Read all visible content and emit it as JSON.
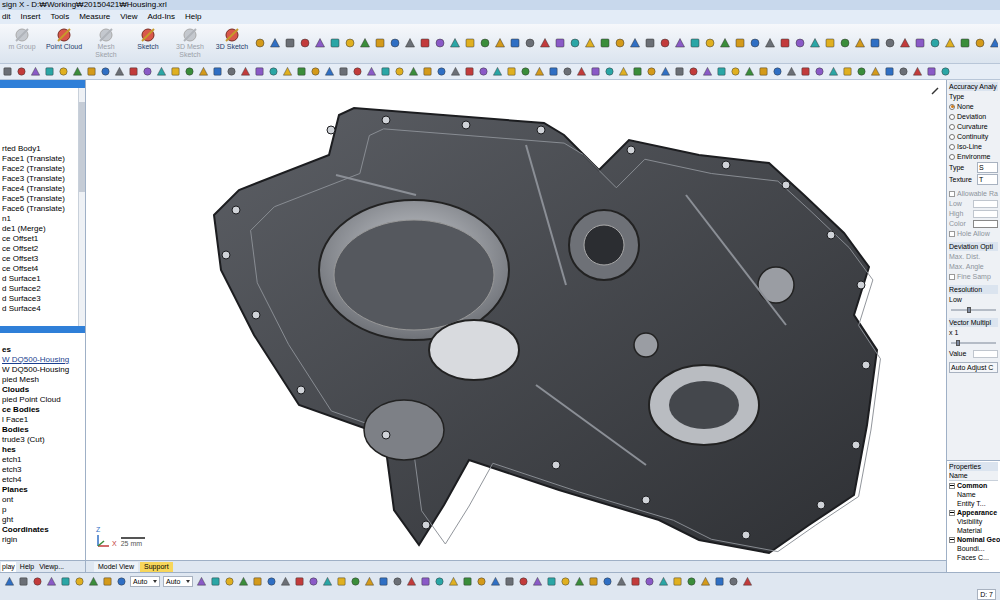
{
  "window": {
    "title": "sign X - D:₩Working₩20150421₩Housing.xrl"
  },
  "menu": [
    "dit",
    "Insert",
    "Tools",
    "Measure",
    "View",
    "Add-Ins",
    "Help"
  ],
  "ribbon": [
    {
      "label": "m Group",
      "disabled": true
    },
    {
      "label": "Point Cloud",
      "disabled": false
    },
    {
      "label": "Mesh Sketch",
      "disabled": true
    },
    {
      "label": "Sketch",
      "disabled": false
    },
    {
      "label": "3D Mesh Sketch",
      "disabled": true
    },
    {
      "label": "3D Sketch",
      "disabled": false
    }
  ],
  "tree_top": [
    {
      "label": "rted Body1",
      "bold": false,
      "selected": false
    },
    {
      "label": "Face1 (Translate)",
      "bold": false,
      "selected": false
    },
    {
      "label": "Face2 (Translate)",
      "bold": false,
      "selected": false
    },
    {
      "label": "Face3 (Translate)",
      "bold": false,
      "selected": false
    },
    {
      "label": "Face4 (Translate)",
      "bold": false,
      "selected": false
    },
    {
      "label": "Face5 (Translate)",
      "bold": false,
      "selected": false
    },
    {
      "label": "Face6 (Translate)",
      "bold": false,
      "selected": false
    },
    {
      "label": "n1",
      "bold": false,
      "selected": false
    },
    {
      "label": "de1 (Merge)",
      "bold": false,
      "selected": false
    },
    {
      "label": "ce Offset1",
      "bold": false,
      "selected": false
    },
    {
      "label": "ce Offset2",
      "bold": false,
      "selected": false
    },
    {
      "label": "ce Offset3",
      "bold": false,
      "selected": false
    },
    {
      "label": "ce Offset4",
      "bold": false,
      "selected": false
    },
    {
      "label": "d Surface1",
      "bold": false,
      "selected": false
    },
    {
      "label": "d Surface2",
      "bold": false,
      "selected": false
    },
    {
      "label": "d Surface3",
      "bold": false,
      "selected": false
    },
    {
      "label": "d Surface4",
      "bold": false,
      "selected": false
    }
  ],
  "tree_bottom": [
    {
      "label": "es",
      "bold": true,
      "selected": false
    },
    {
      "label": "W DQ500-Housing",
      "bold": false,
      "selected": true
    },
    {
      "label": "W DQ500-Housing",
      "bold": false,
      "selected": false
    },
    {
      "label": "pied Mesh",
      "bold": false,
      "selected": false
    },
    {
      "label": "Clouds",
      "bold": true,
      "selected": false
    },
    {
      "label": "pied Point Cloud",
      "bold": false,
      "selected": false
    },
    {
      "label": "ce Bodies",
      "bold": true,
      "selected": false
    },
    {
      "label": "l Face1",
      "bold": false,
      "selected": false
    },
    {
      "label": "Bodies",
      "bold": true,
      "selected": false
    },
    {
      "label": "trude3 (Cut)",
      "bold": false,
      "selected": false
    },
    {
      "label": "hes",
      "bold": true,
      "selected": false
    },
    {
      "label": "etch1",
      "bold": false,
      "selected": false
    },
    {
      "label": "etch3",
      "bold": false,
      "selected": false
    },
    {
      "label": "etch4",
      "bold": false,
      "selected": false
    },
    {
      "label": "Planes",
      "bold": true,
      "selected": false
    },
    {
      "label": "ont",
      "bold": false,
      "selected": false
    },
    {
      "label": "p",
      "bold": false,
      "selected": false
    },
    {
      "label": "ght",
      "bold": false,
      "selected": false
    },
    {
      "label": "Coordinates",
      "bold": true,
      "selected": false
    },
    {
      "label": "rigin",
      "bold": false,
      "selected": false
    }
  ],
  "left_tabs": [
    {
      "label": "play",
      "selected": true
    },
    {
      "label": "Help",
      "selected": false
    },
    {
      "label": "Viewp...",
      "selected": false
    }
  ],
  "viewport": {
    "tabs": [
      {
        "label": "Model View",
        "selected": false
      },
      {
        "label": "Support",
        "selected": true
      }
    ],
    "scale": "25 mm",
    "axis_z": "Z",
    "axis_x": "X"
  },
  "accuracy": {
    "title": "Accuracy Analy",
    "type_label": "Type",
    "options": [
      {
        "label": "None",
        "selected": true
      },
      {
        "label": "Deviation",
        "selected": false
      },
      {
        "label": "Curvature",
        "selected": false
      },
      {
        "label": "Continuity",
        "selected": false
      },
      {
        "label": "Iso-Line",
        "selected": false
      },
      {
        "label": "Environme",
        "selected": false
      }
    ],
    "fields": [
      {
        "label": "Type",
        "value": "S"
      },
      {
        "label": "Texture",
        "value": "T"
      }
    ],
    "allowable": {
      "label": "Allowable Ra",
      "checked": false,
      "disabled": true,
      "low": "Low",
      "high": "High",
      "color": "Color",
      "hole": "Hole Allow"
    },
    "deviation": {
      "title": "Deviation Opti",
      "max_dist": "Max. Dist.",
      "max_angle": "Max. Angle",
      "fine": "Fine Samp",
      "fine_checked": false,
      "disabled": true
    },
    "resolution": {
      "title": "Resolution",
      "label": "Low",
      "level": 0.35
    },
    "vector": {
      "title": "Vector Multipl",
      "label": "x 1",
      "level": 0.12,
      "value_label": "Value"
    },
    "button": "Auto Adjust C"
  },
  "properties": {
    "title": "Properties",
    "column": "Name",
    "groups": [
      {
        "label": "Common",
        "expanded": true,
        "rows": [
          "Name",
          "Entity T..."
        ]
      },
      {
        "label": "Appearance",
        "expanded": true,
        "rows": [
          "Visibility",
          "Material"
        ]
      },
      {
        "label": "Nominal Geo",
        "expanded": true,
        "rows": [
          "Boundi...",
          "Faces C..."
        ]
      }
    ]
  },
  "status": {
    "dropdowns": [
      "Auto",
      "Auto"
    ],
    "corner": "D: 7"
  }
}
